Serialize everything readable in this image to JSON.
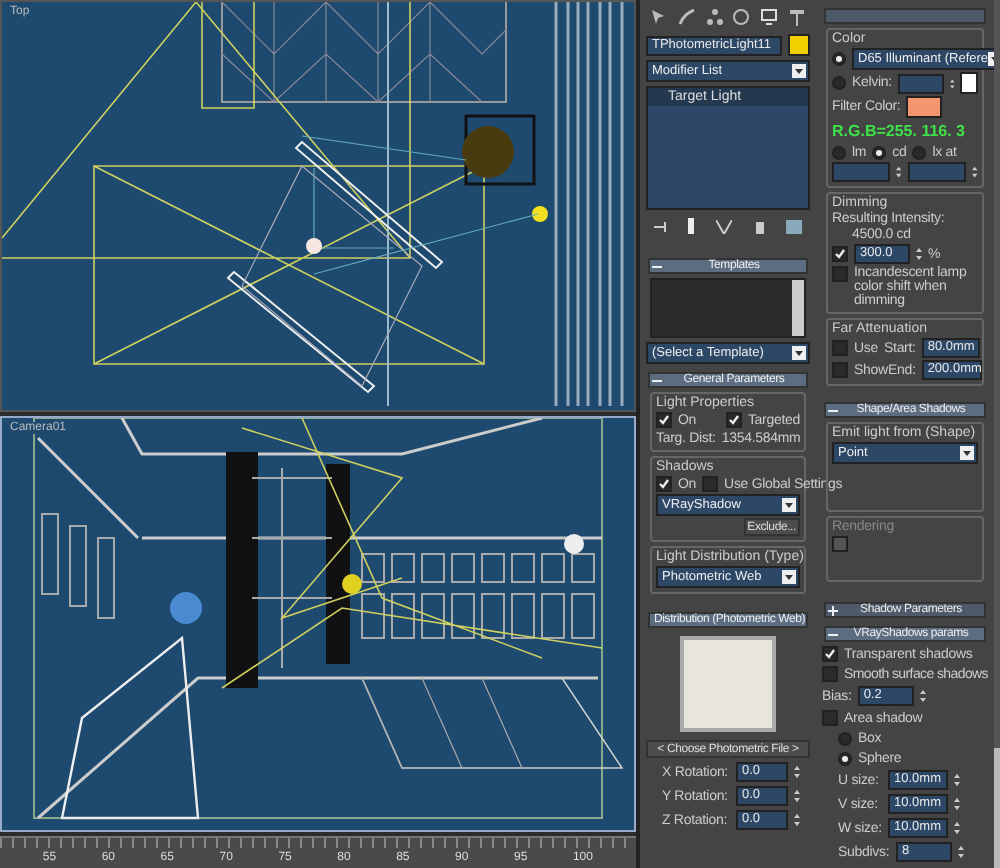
{
  "viewports": [
    {
      "label": "Top",
      "active": false
    },
    {
      "label": "Camera01",
      "active": true
    }
  ],
  "timeline": {
    "ticks": [
      "55",
      "60",
      "65",
      "70",
      "75",
      "80",
      "85",
      "90",
      "95",
      "100"
    ]
  },
  "panel": {
    "object_name": "TPhotometricLight11",
    "modifier_list": "Modifier List",
    "stack": [
      {
        "label": "Target Light",
        "selected": true
      }
    ],
    "templates": {
      "title": "Templates",
      "expanded": true,
      "select": "(Select a Template)"
    },
    "general": {
      "title": "General Parameters",
      "expanded": true,
      "light_properties": "Light Properties",
      "light_on": {
        "label": "On",
        "checked": true
      },
      "targeted": {
        "label": "Targeted",
        "checked": true
      },
      "targ_dist_label": "Targ. Dist:",
      "targ_dist": "1354.584mm",
      "shadows": "Shadows",
      "shadows_on": {
        "label": "On",
        "checked": true
      },
      "use_global": {
        "label": "Use Global Settings",
        "checked": false
      },
      "shadow_type": "VRayShadow",
      "exclude": "Exclude...",
      "distribution_label": "Light Distribution (Type)",
      "distribution": "Photometric Web"
    },
    "web": {
      "title": "Distribution (Photometric Web)",
      "expanded": true,
      "choose": "< Choose Photometric File >",
      "rotations": [
        {
          "label": "X Rotation:",
          "value": "0.0"
        },
        {
          "label": "Y Rotation:",
          "value": "0.0"
        },
        {
          "label": "Z Rotation:",
          "value": "0.0"
        }
      ]
    },
    "color": {
      "title": "Color",
      "preset": {
        "selected": true,
        "value": "D65 Illuminant (Refere"
      },
      "kelvin": {
        "label": "Kelvin:",
        "selected": false
      },
      "filter_label": "Filter Color:",
      "rgb_note": "R.G.B=255. 116. 3",
      "units": [
        {
          "label": "lm",
          "selected": false
        },
        {
          "label": "cd",
          "selected": true
        },
        {
          "label": "lx at",
          "selected": false
        }
      ]
    },
    "dimming": {
      "title": "Dimming",
      "resulting_label": "Resulting Intensity:",
      "resulting": "4500.0 cd",
      "percent_on": true,
      "percent": "300.0",
      "percent_unit": "%",
      "incandescent": {
        "label": "Incandescent lamp color shift when dimming",
        "checked": false
      }
    },
    "far": {
      "title": "Far Attenuation",
      "use": {
        "label": "Use",
        "checked": false
      },
      "show": {
        "label": "Show",
        "checked": false
      },
      "start_label": "Start:",
      "start": "80.0mm",
      "end_label": "End:",
      "end": "200.0mm"
    },
    "shape": {
      "title": "Shape/Area Shadows",
      "expanded": true,
      "emit_label": "Emit light from (Shape)",
      "emit": "Point",
      "rendering": "Rendering",
      "rendering_checked": false
    },
    "shadow_params": {
      "title": "Shadow Parameters",
      "expanded": false
    },
    "vray": {
      "title": "VRayShadows params",
      "expanded": true,
      "transparent": {
        "label": "Transparent shadows",
        "checked": true
      },
      "smooth": {
        "label": "Smooth surface shadows",
        "checked": false
      },
      "bias_label": "Bias:",
      "bias": "0.2",
      "area": {
        "label": "Area shadow",
        "checked": false
      },
      "area_shape": [
        {
          "label": "Box",
          "selected": false
        },
        {
          "label": "Sphere",
          "selected": true
        }
      ],
      "sizes": [
        {
          "label": "U size:",
          "value": "10.0mm"
        },
        {
          "label": "V size:",
          "value": "10.0mm"
        },
        {
          "label": "W size:",
          "value": "10.0mm"
        }
      ],
      "subdivs_label": "Subdivs:",
      "subdivs": "8"
    }
  }
}
